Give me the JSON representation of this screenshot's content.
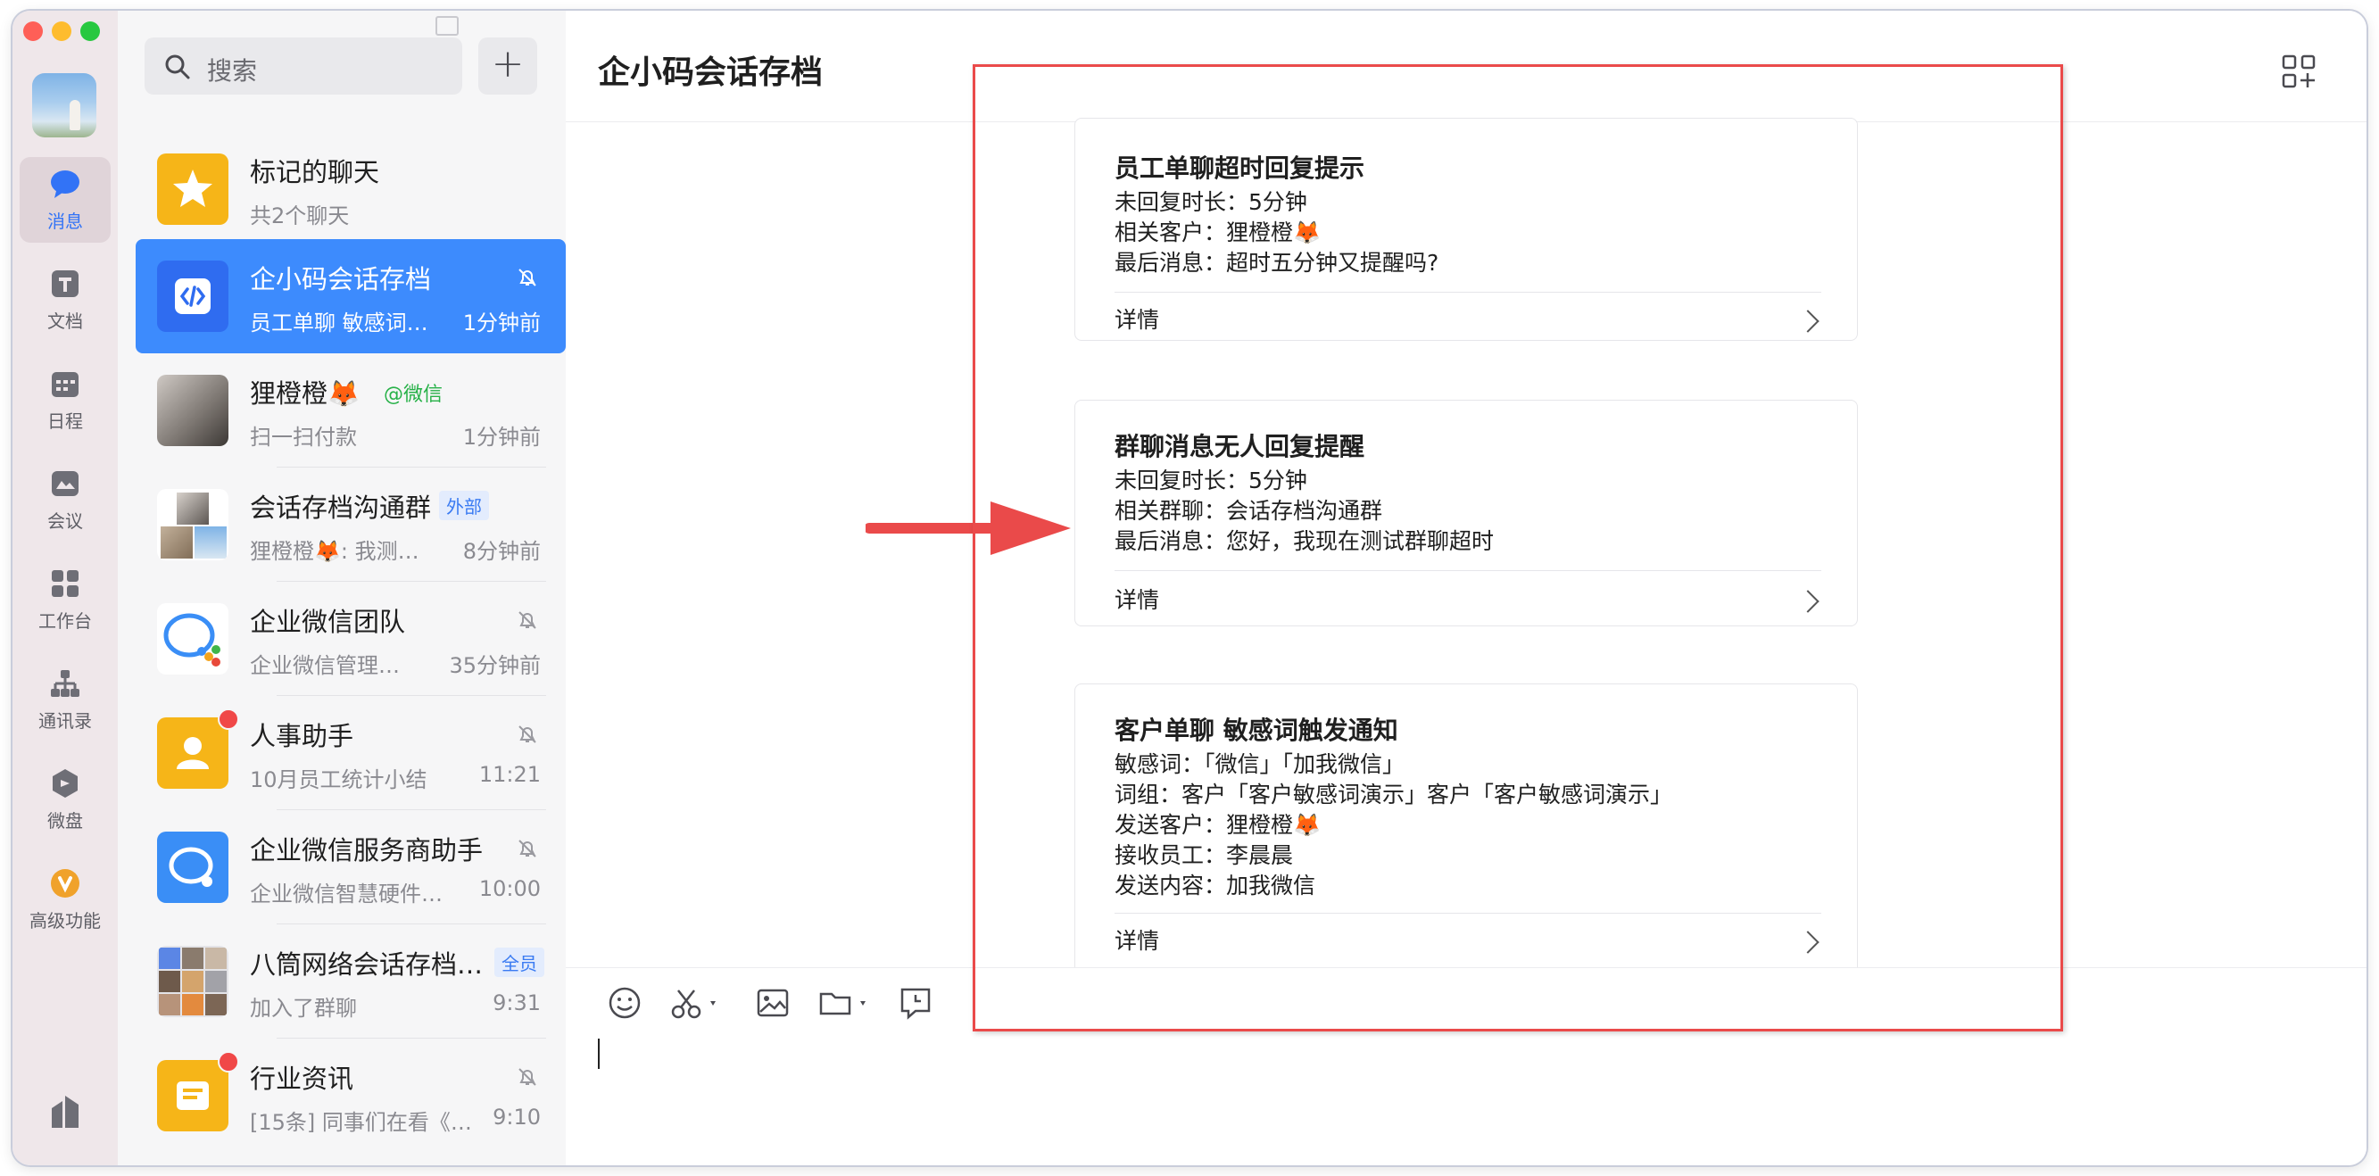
{
  "sidebar": {
    "items": [
      {
        "label": "消息",
        "icon": "chat-bubble-icon",
        "active": true
      },
      {
        "label": "文档",
        "icon": "document-icon"
      },
      {
        "label": "日程",
        "icon": "calendar-icon"
      },
      {
        "label": "会议",
        "icon": "meeting-icon"
      },
      {
        "label": "工作台",
        "icon": "workbench-icon"
      },
      {
        "label": "通讯录",
        "icon": "contacts-icon"
      },
      {
        "label": "微盘",
        "icon": "cloud-drive-icon"
      },
      {
        "label": "高级功能",
        "icon": "advanced-features-icon"
      }
    ]
  },
  "search": {
    "placeholder": "搜索"
  },
  "chats": [
    {
      "name": "标记的聊天",
      "preview": "共2个聊天",
      "time": ""
    },
    {
      "name": "企小码会话存档",
      "preview": "员工单聊 敏感词…",
      "time": "1分钟前"
    },
    {
      "name": "狸橙橙🦊",
      "tag": "@微信",
      "preview": "扫一扫付款",
      "time": "1分钟前"
    },
    {
      "name": "会话存档沟通群",
      "tag": "外部",
      "preview": "狸橙橙🦊: 我测…",
      "time": "8分钟前"
    },
    {
      "name": "企业微信团队",
      "preview": "企业微信管理…",
      "time": "35分钟前"
    },
    {
      "name": "人事助手",
      "preview": "10月员工统计小结",
      "time": "11:21"
    },
    {
      "name": "企业微信服务商助手",
      "preview": "企业微信智慧硬件…",
      "time": "10:00"
    },
    {
      "name": "八筒网络会话存档…",
      "tag": "全员",
      "preview": "加入了群聊",
      "time": "9:31"
    },
    {
      "name": "行业资讯",
      "preview": "[15条] 同事们在看《…",
      "time": "9:10"
    }
  ],
  "main": {
    "title": "企小码会话存档",
    "cards": [
      {
        "title": "员工单聊超时回复提示",
        "lines": [
          "未回复时长：5分钟",
          "相关客户：狸橙橙🦊",
          "最后消息：超时五分钟又提醒吗?"
        ],
        "detail": "详情"
      },
      {
        "title": "群聊消息无人回复提醒",
        "lines": [
          "未回复时长：5分钟",
          "相关群聊：会话存档沟通群",
          "最后消息：您好，我现在测试群聊超时"
        ],
        "detail": "详情"
      },
      {
        "title": "客户单聊 敏感词触发通知",
        "lines": [
          "敏感词：「微信」「加我微信」",
          "词组：客户「客户敏感词演示」客户「客户敏感词演示」",
          "发送客户：狸橙橙🦊",
          "接收员工：李晨晨",
          "发送内容：加我微信"
        ],
        "detail": "详情"
      }
    ]
  },
  "colors": {
    "accent": "#3d8bfd",
    "annotation": "#ea4a4a",
    "rail_bg": "#efe7ea"
  }
}
